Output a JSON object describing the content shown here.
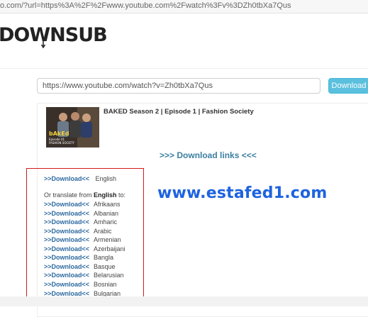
{
  "browser": {
    "address": "o.com/?url=https%3A%2F%2Fwww.youtube.com%2Fwatch%3Fv%3DZh0tbXa7Qus"
  },
  "site": {
    "logo_text": "DOWNSUB"
  },
  "search": {
    "value": "https://www.youtube.com/watch?v=Zh0tbXa7Qus",
    "button_label": "Download"
  },
  "video": {
    "title": "BAKED Season 2 | Episode 1 | Fashion Society"
  },
  "links_header": ">>> Download links <<<",
  "original": {
    "link_label": ">>Download<<",
    "language": "English"
  },
  "translate": {
    "prefix": "Or translate from ",
    "source_language": "English",
    "suffix": " to:"
  },
  "translations": [
    {
      "link_label": ">>Download<<",
      "language": "Afrikaans"
    },
    {
      "link_label": ">>Download<<",
      "language": "Albanian"
    },
    {
      "link_label": ">>Download<<",
      "language": "Amharic"
    },
    {
      "link_label": ">>Download<<",
      "language": "Arabic"
    },
    {
      "link_label": ">>Download<<",
      "language": "Armenian"
    },
    {
      "link_label": ">>Download<<",
      "language": "Azerbaijani"
    },
    {
      "link_label": ">>Download<<",
      "language": "Bangla"
    },
    {
      "link_label": ">>Download<<",
      "language": "Basque"
    },
    {
      "link_label": ">>Download<<",
      "language": "Belarusian"
    },
    {
      "link_label": ">>Download<<",
      "language": "Bosnian"
    },
    {
      "link_label": ">>Download<<",
      "language": "Bulgarian"
    }
  ],
  "watermark": "www.estafed1.com",
  "colors": {
    "link": "#2d6aa0",
    "header_link": "#3b7fa0",
    "button": "#5bc0de",
    "highlight_box": "#d11a1a",
    "watermark": "#1e63e0"
  }
}
